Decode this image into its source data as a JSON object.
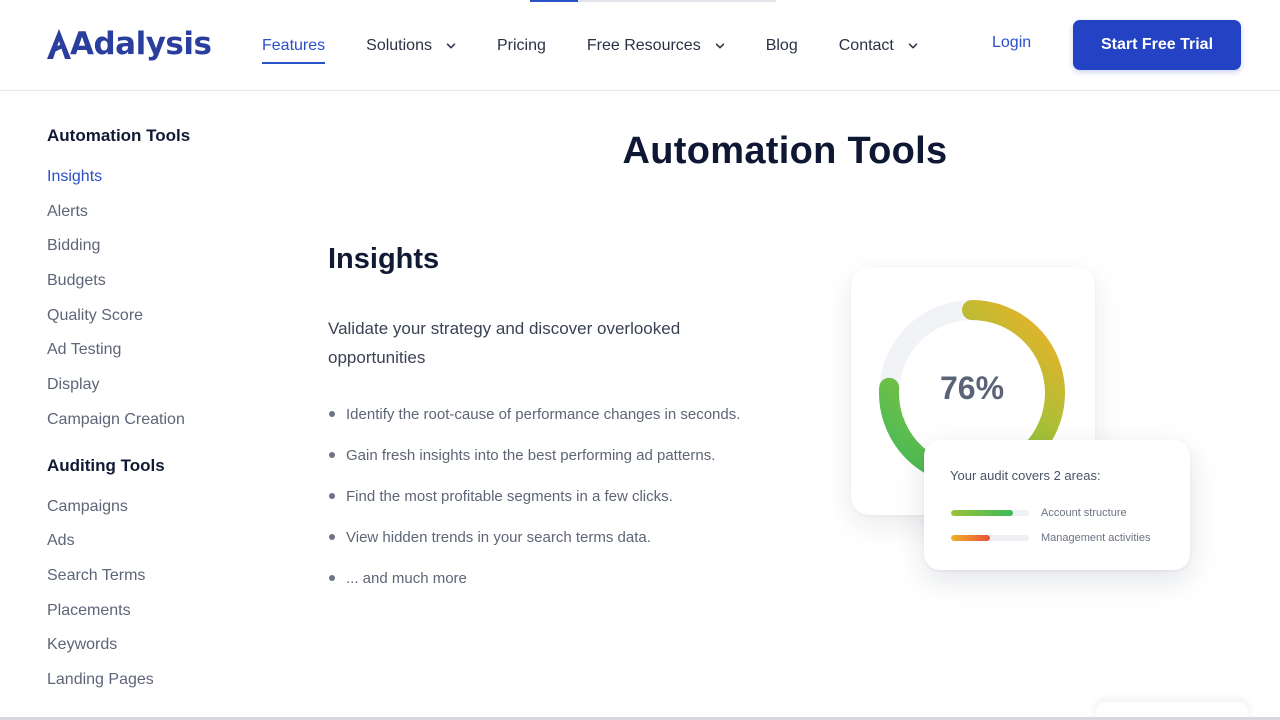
{
  "brand": {
    "name": "Adalysis",
    "color": "#2a3f9d"
  },
  "nav": {
    "items": [
      {
        "label": "Features",
        "active": true,
        "dropdown": false
      },
      {
        "label": "Solutions",
        "active": false,
        "dropdown": true
      },
      {
        "label": "Pricing",
        "active": false,
        "dropdown": false
      },
      {
        "label": "Free Resources",
        "active": false,
        "dropdown": true
      },
      {
        "label": "Blog",
        "active": false,
        "dropdown": false
      },
      {
        "label": "Contact",
        "active": false,
        "dropdown": true
      }
    ],
    "login": "Login",
    "cta": "Start Free Trial"
  },
  "sidebar": {
    "automation": {
      "title": "Automation Tools",
      "items": [
        "Insights",
        "Alerts",
        "Bidding",
        "Budgets",
        "Quality Score",
        "Ad Testing",
        "Display",
        "Campaign Creation"
      ],
      "active_index": 0
    },
    "auditing": {
      "title": "Auditing Tools",
      "items": [
        "Campaigns",
        "Ads",
        "Search Terms",
        "Placements",
        "Keywords",
        "Landing Pages"
      ]
    }
  },
  "main": {
    "page_title": "Automation Tools",
    "section_title": "Insights",
    "description": "Validate your strategy and discover overlooked opportunities",
    "bullets": [
      "Identify the root-cause of performance changes in seconds.",
      "Gain fresh insights into the best performing ad patterns.",
      "Find the most profitable segments in a few clicks.",
      "View hidden trends in your search terms data.",
      "... and much more"
    ]
  },
  "illustration": {
    "score_label": "76%",
    "score_value": 76,
    "audit_title": "Your audit covers 2 areas:",
    "areas": [
      {
        "label": "Account structure",
        "fill": 0.8
      },
      {
        "label": "Management activities",
        "fill": 0.5
      }
    ],
    "colors": {
      "green": "#3cba59",
      "yellow": "#f2b027",
      "red": "#e8503a",
      "accent": "#2b4fc9"
    }
  }
}
